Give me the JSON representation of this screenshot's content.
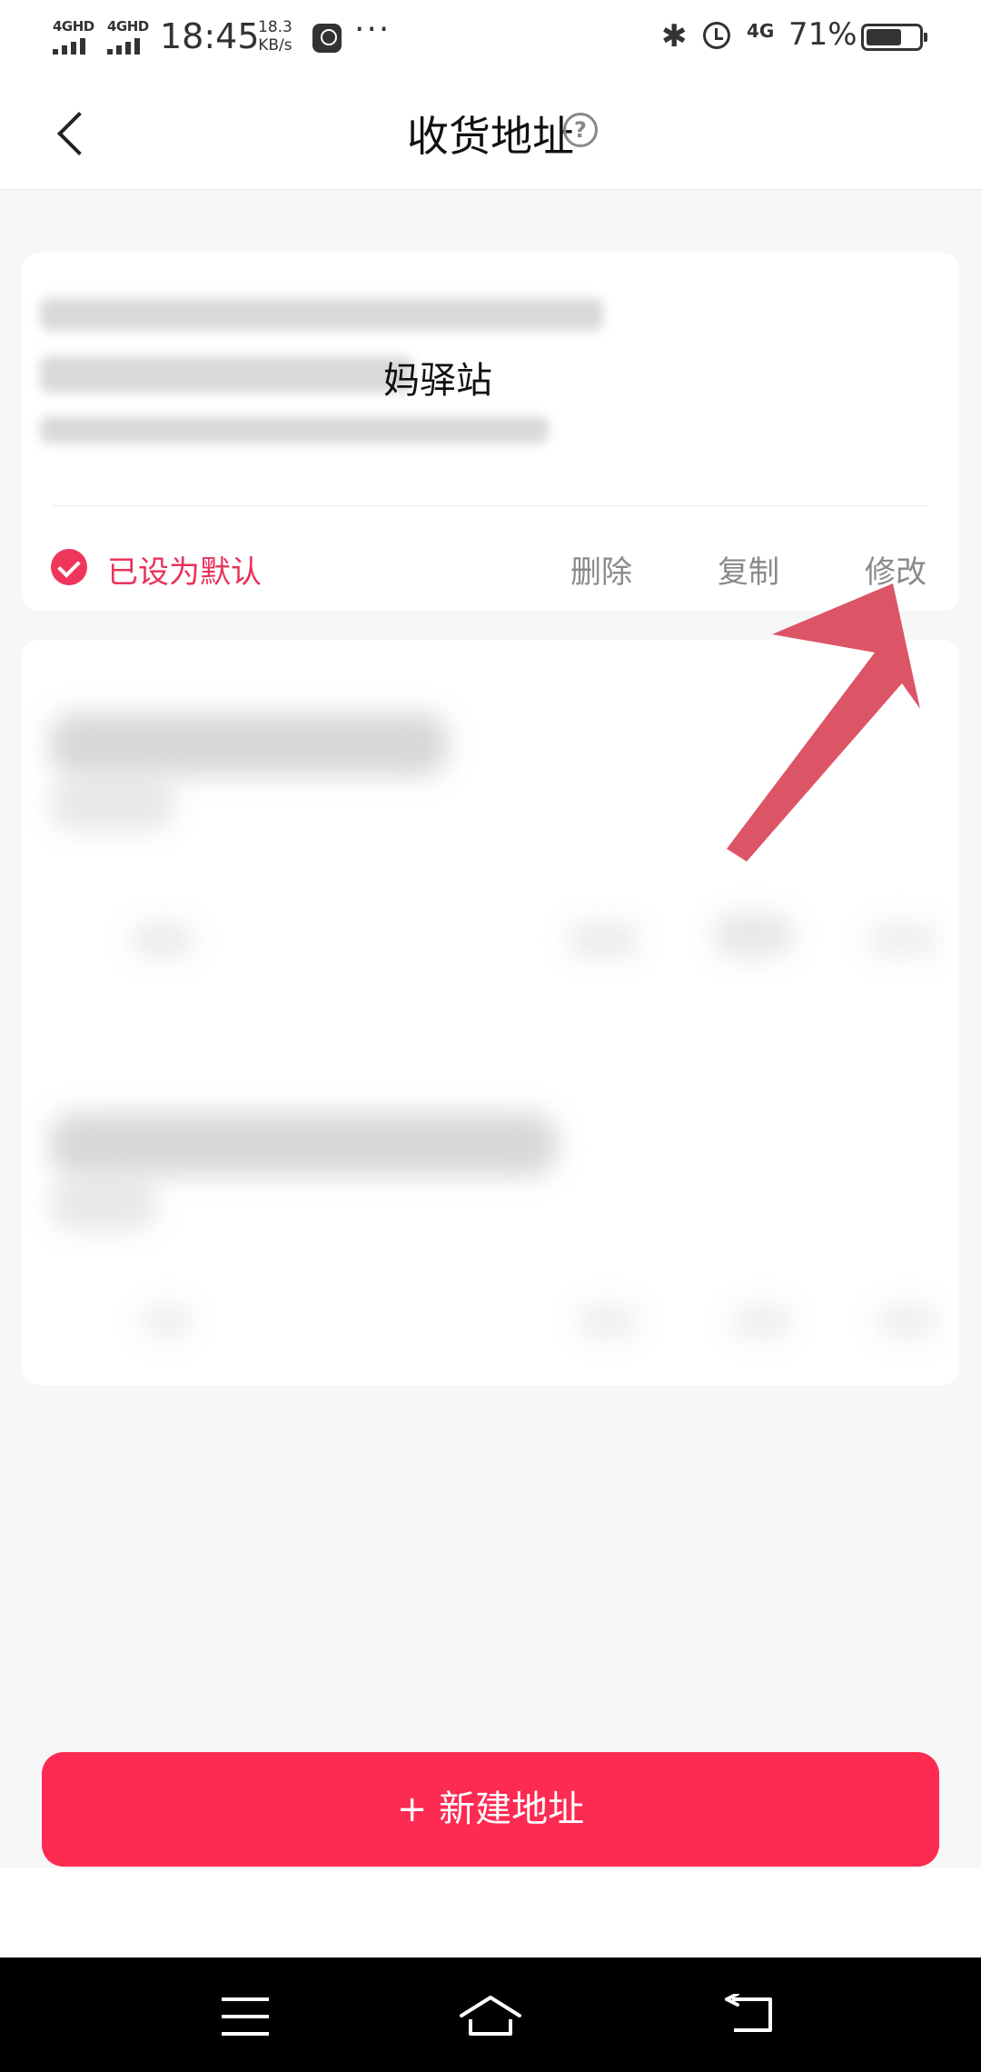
{
  "status_bar": {
    "signal1": "4GHD",
    "signal2": "4GHD",
    "time": "18:45",
    "speed_value": "18.3",
    "speed_unit": "KB/s",
    "more": "···",
    "network": "4G",
    "battery_pct": "71%",
    "battery_level": 0.71,
    "icons": [
      "video-app-icon",
      "bluetooth-icon",
      "alarm-icon",
      "battery-icon"
    ]
  },
  "header": {
    "title": "收货地址",
    "help": "?"
  },
  "address_card": {
    "line2_visible": "妈驿站",
    "default_label": "已设为默认",
    "actions": {
      "delete": "删除",
      "copy": "复制",
      "edit": "修改"
    }
  },
  "new_address_button": "+ 新建地址",
  "colors": {
    "accent": "#fd2a52",
    "default_text": "#e8335a",
    "arrow": "#d9475a"
  }
}
